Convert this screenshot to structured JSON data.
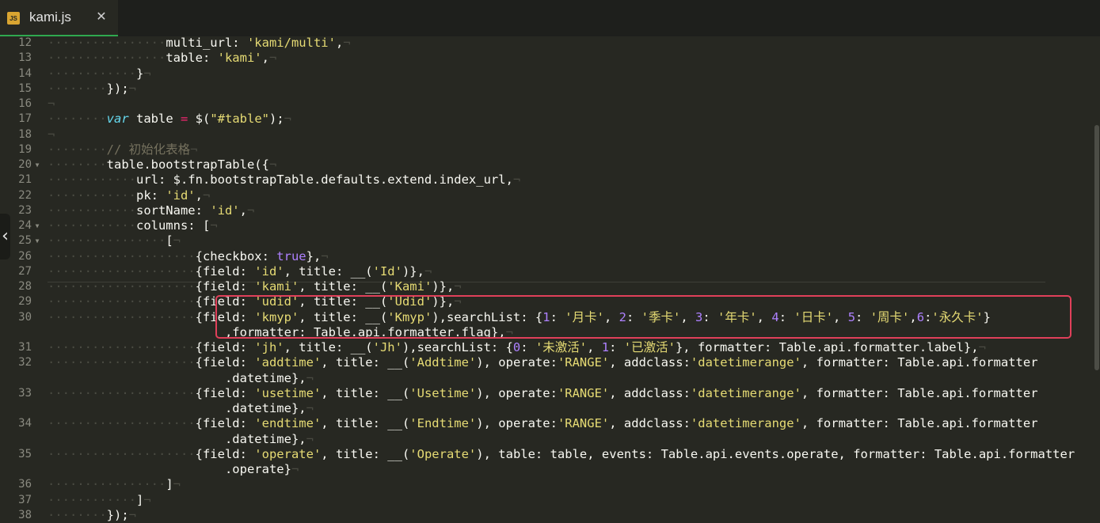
{
  "tab": {
    "file_name": "kami.js",
    "icon_label": "JS",
    "close_glyph": "✕"
  },
  "side_handle_glyph": "‹",
  "editor": {
    "colors": {
      "background": "#272822",
      "plain": "#f8f8f2",
      "string": "#e6db74",
      "keyword": "#66d9ef",
      "number": "#ae81ff",
      "comment": "#75715e",
      "operator": "#f92672",
      "highlight_box": "#e0405a",
      "active_tab_underline": "#2fa84f"
    },
    "gutter": [
      {
        "number": "12",
        "fold": ""
      },
      {
        "number": "13",
        "fold": ""
      },
      {
        "number": "14",
        "fold": ""
      },
      {
        "number": "15",
        "fold": ""
      },
      {
        "number": "16",
        "fold": ""
      },
      {
        "number": "17",
        "fold": ""
      },
      {
        "number": "18",
        "fold": ""
      },
      {
        "number": "19",
        "fold": ""
      },
      {
        "number": "20",
        "fold": "▼"
      },
      {
        "number": "21",
        "fold": ""
      },
      {
        "number": "22",
        "fold": ""
      },
      {
        "number": "23",
        "fold": ""
      },
      {
        "number": "24",
        "fold": "▼"
      },
      {
        "number": "25",
        "fold": "▼"
      },
      {
        "number": "26",
        "fold": ""
      },
      {
        "number": "27",
        "fold": ""
      },
      {
        "number": "28",
        "fold": ""
      },
      {
        "number": "29",
        "fold": ""
      },
      {
        "number": "30",
        "fold": ""
      },
      {
        "number": "",
        "fold": ""
      },
      {
        "number": "31",
        "fold": ""
      },
      {
        "number": "32",
        "fold": ""
      },
      {
        "number": "",
        "fold": ""
      },
      {
        "number": "33",
        "fold": ""
      },
      {
        "number": "",
        "fold": ""
      },
      {
        "number": "34",
        "fold": ""
      },
      {
        "number": "",
        "fold": ""
      },
      {
        "number": "35",
        "fold": ""
      },
      {
        "number": "",
        "fold": ""
      },
      {
        "number": "36",
        "fold": ""
      },
      {
        "number": "37",
        "fold": ""
      },
      {
        "number": "38",
        "fold": ""
      }
    ],
    "lines": [
      [
        [
          "w",
          "················"
        ],
        [
          "p",
          "multi_url: "
        ],
        [
          "s",
          "'kami/multi'"
        ],
        [
          "p",
          ","
        ],
        [
          "w",
          "¬"
        ]
      ],
      [
        [
          "w",
          "················"
        ],
        [
          "p",
          "table: "
        ],
        [
          "s",
          "'kami'"
        ],
        [
          "p",
          ","
        ],
        [
          "w",
          "¬"
        ]
      ],
      [
        [
          "w",
          "············"
        ],
        [
          "p",
          "}"
        ],
        [
          "w",
          "¬"
        ]
      ],
      [
        [
          "w",
          "········"
        ],
        [
          "p",
          "});"
        ],
        [
          "w",
          "¬"
        ]
      ],
      [
        [
          "w",
          "¬"
        ]
      ],
      [
        [
          "w",
          "········"
        ],
        [
          "k",
          "var"
        ],
        [
          "p",
          " table "
        ],
        [
          "o",
          "="
        ],
        [
          "p",
          " $("
        ],
        [
          "s",
          "\"#table\""
        ],
        [
          "p",
          ");"
        ],
        [
          "w",
          "¬"
        ]
      ],
      [
        [
          "w",
          "¬"
        ]
      ],
      [
        [
          "w",
          "········"
        ],
        [
          "c",
          "// 初始化表格"
        ],
        [
          "w",
          "¬"
        ]
      ],
      [
        [
          "w",
          "········"
        ],
        [
          "p",
          "table.bootstrapTable({"
        ],
        [
          "w",
          "¬"
        ]
      ],
      [
        [
          "w",
          "············"
        ],
        [
          "p",
          "url: $.fn.bootstrapTable.defaults.extend.index_url,"
        ],
        [
          "w",
          "¬"
        ]
      ],
      [
        [
          "w",
          "············"
        ],
        [
          "p",
          "pk: "
        ],
        [
          "s",
          "'id'"
        ],
        [
          "p",
          ","
        ],
        [
          "w",
          "¬"
        ]
      ],
      [
        [
          "w",
          "············"
        ],
        [
          "p",
          "sortName: "
        ],
        [
          "s",
          "'id'"
        ],
        [
          "p",
          ","
        ],
        [
          "w",
          "¬"
        ]
      ],
      [
        [
          "w",
          "············"
        ],
        [
          "p",
          "columns: ["
        ],
        [
          "w",
          "¬"
        ]
      ],
      [
        [
          "w",
          "················"
        ],
        [
          "p",
          "["
        ],
        [
          "w",
          "¬"
        ]
      ],
      [
        [
          "w",
          "····················"
        ],
        [
          "p",
          "{checkbox: "
        ],
        [
          "n",
          "true"
        ],
        [
          "p",
          "},"
        ],
        [
          "w",
          "¬"
        ]
      ],
      [
        [
          "w",
          "····················"
        ],
        [
          "p",
          "{field: "
        ],
        [
          "s",
          "'id'"
        ],
        [
          "p",
          ", title: __("
        ],
        [
          "s",
          "'Id'"
        ],
        [
          "p",
          ")},"
        ],
        [
          "w",
          "¬"
        ]
      ],
      [
        [
          "w",
          "····················"
        ],
        [
          "p",
          "{field: "
        ],
        [
          "s",
          "'kami'"
        ],
        [
          "p",
          ", title: __("
        ],
        [
          "s",
          "'Kami'"
        ],
        [
          "p",
          ")},"
        ],
        [
          "w",
          "¬"
        ]
      ],
      [
        [
          "w",
          "····················"
        ],
        [
          "p",
          "{field: "
        ],
        [
          "s",
          "'udid'"
        ],
        [
          "p",
          ", title: __("
        ],
        [
          "s",
          "'Udid'"
        ],
        [
          "p",
          ")},"
        ],
        [
          "w",
          "¬"
        ]
      ],
      [
        [
          "w",
          "····················"
        ],
        [
          "p",
          "{field: "
        ],
        [
          "s",
          "'kmyp'"
        ],
        [
          "p",
          ", title: __("
        ],
        [
          "s",
          "'Kmyp'"
        ],
        [
          "p",
          "),searchList: {"
        ],
        [
          "n",
          "1"
        ],
        [
          "p",
          ": "
        ],
        [
          "s",
          "'月卡'"
        ],
        [
          "p",
          ", "
        ],
        [
          "n",
          "2"
        ],
        [
          "p",
          ": "
        ],
        [
          "s",
          "'季卡'"
        ],
        [
          "p",
          ", "
        ],
        [
          "n",
          "3"
        ],
        [
          "p",
          ": "
        ],
        [
          "s",
          "'年卡'"
        ],
        [
          "p",
          ", "
        ],
        [
          "n",
          "4"
        ],
        [
          "p",
          ": "
        ],
        [
          "s",
          "'日卡'"
        ],
        [
          "p",
          ", "
        ],
        [
          "n",
          "5"
        ],
        [
          "p",
          ": "
        ],
        [
          "s",
          "'周卡'"
        ],
        [
          "p",
          ","
        ],
        [
          "n",
          "6"
        ],
        [
          "p",
          ":"
        ],
        [
          "s",
          "'永久卡'"
        ],
        [
          "p",
          "}"
        ]
      ],
      [
        [
          "p",
          "                        ,formatter: Table.api.formatter.flag},"
        ],
        [
          "w",
          "¬"
        ]
      ],
      [
        [
          "w",
          "····················"
        ],
        [
          "p",
          "{field: "
        ],
        [
          "s",
          "'jh'"
        ],
        [
          "p",
          ", title: __("
        ],
        [
          "s",
          "'Jh'"
        ],
        [
          "p",
          "),searchList: {"
        ],
        [
          "n",
          "0"
        ],
        [
          "p",
          ": "
        ],
        [
          "s",
          "'未激活'"
        ],
        [
          "p",
          ", "
        ],
        [
          "n",
          "1"
        ],
        [
          "p",
          ": "
        ],
        [
          "s",
          "'已激活'"
        ],
        [
          "p",
          "}, formatter: Table.api.formatter.label},"
        ],
        [
          "w",
          "¬"
        ]
      ],
      [
        [
          "w",
          "····················"
        ],
        [
          "p",
          "{field: "
        ],
        [
          "s",
          "'addtime'"
        ],
        [
          "p",
          ", title: __("
        ],
        [
          "s",
          "'Addtime'"
        ],
        [
          "p",
          "), operate:"
        ],
        [
          "s",
          "'RANGE'"
        ],
        [
          "p",
          ", addclass:"
        ],
        [
          "s",
          "'datetimerange'"
        ],
        [
          "p",
          ", formatter: Table.api.formatter"
        ]
      ],
      [
        [
          "p",
          "                        .datetime},"
        ],
        [
          "w",
          "¬"
        ]
      ],
      [
        [
          "w",
          "····················"
        ],
        [
          "p",
          "{field: "
        ],
        [
          "s",
          "'usetime'"
        ],
        [
          "p",
          ", title: __("
        ],
        [
          "s",
          "'Usetime'"
        ],
        [
          "p",
          "), operate:"
        ],
        [
          "s",
          "'RANGE'"
        ],
        [
          "p",
          ", addclass:"
        ],
        [
          "s",
          "'datetimerange'"
        ],
        [
          "p",
          ", formatter: Table.api.formatter"
        ]
      ],
      [
        [
          "p",
          "                        .datetime},"
        ],
        [
          "w",
          "¬"
        ]
      ],
      [
        [
          "w",
          "····················"
        ],
        [
          "p",
          "{field: "
        ],
        [
          "s",
          "'endtime'"
        ],
        [
          "p",
          ", title: __("
        ],
        [
          "s",
          "'Endtime'"
        ],
        [
          "p",
          "), operate:"
        ],
        [
          "s",
          "'RANGE'"
        ],
        [
          "p",
          ", addclass:"
        ],
        [
          "s",
          "'datetimerange'"
        ],
        [
          "p",
          ", formatter: Table.api.formatter"
        ]
      ],
      [
        [
          "p",
          "                        .datetime},"
        ],
        [
          "w",
          "¬"
        ]
      ],
      [
        [
          "w",
          "····················"
        ],
        [
          "p",
          "{field: "
        ],
        [
          "s",
          "'operate'"
        ],
        [
          "p",
          ", title: __("
        ],
        [
          "s",
          "'Operate'"
        ],
        [
          "p",
          "), table: table, events: Table.api.events.operate, formatter: Table.api.formatter"
        ]
      ],
      [
        [
          "p",
          "                        .operate}"
        ],
        [
          "w",
          "¬"
        ]
      ],
      [
        [
          "w",
          "················"
        ],
        [
          "p",
          "]"
        ],
        [
          "w",
          "¬"
        ]
      ],
      [
        [
          "w",
          "············"
        ],
        [
          "p",
          "]"
        ],
        [
          "w",
          "¬"
        ]
      ],
      [
        [
          "w",
          "········"
        ],
        [
          "p",
          "});"
        ],
        [
          "w",
          "¬"
        ]
      ]
    ]
  }
}
